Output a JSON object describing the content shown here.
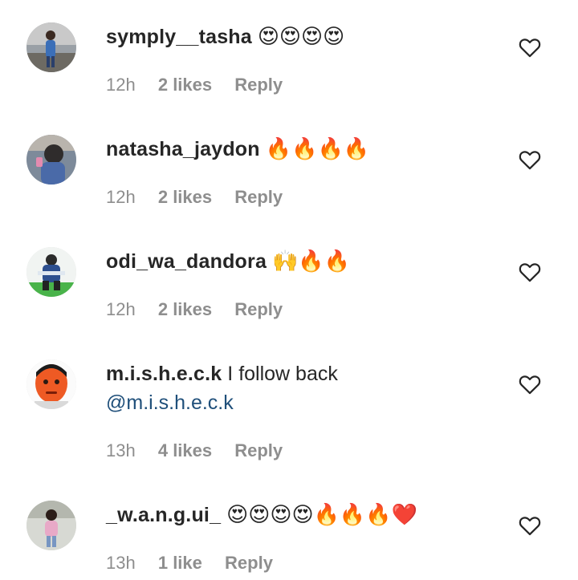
{
  "comments": [
    {
      "username": "symply__tasha",
      "text": "😍😍😍😍",
      "time": "12h",
      "likes": "2 likes",
      "reply": "Reply",
      "like_icon": "heart-outline-icon"
    },
    {
      "username": "natasha_jaydon",
      "text": "🔥🔥🔥🔥",
      "time": "12h",
      "likes": "2 likes",
      "reply": "Reply",
      "like_icon": "heart-outline-icon"
    },
    {
      "username": "odi_wa_dandora",
      "text": "🙌🔥🔥",
      "time": "12h",
      "likes": "2 likes",
      "reply": "Reply",
      "like_icon": "heart-outline-icon"
    },
    {
      "username": "m.i.s.h.e.c.k",
      "text": "I follow back",
      "mention": "@m.i.s.h.e.c.k",
      "time": "13h",
      "likes": "4 likes",
      "reply": "Reply",
      "like_icon": "heart-outline-icon"
    },
    {
      "username": "_w.a.n.g.ui_",
      "text": "😍😍😍😍🔥🔥🔥❤️",
      "time": "13h",
      "likes": "1 like",
      "reply": "Reply",
      "like_icon": "heart-outline-icon"
    }
  ],
  "colors": {
    "text": "#262626",
    "meta": "#8e8e8e",
    "mention": "#1f4f7a"
  }
}
